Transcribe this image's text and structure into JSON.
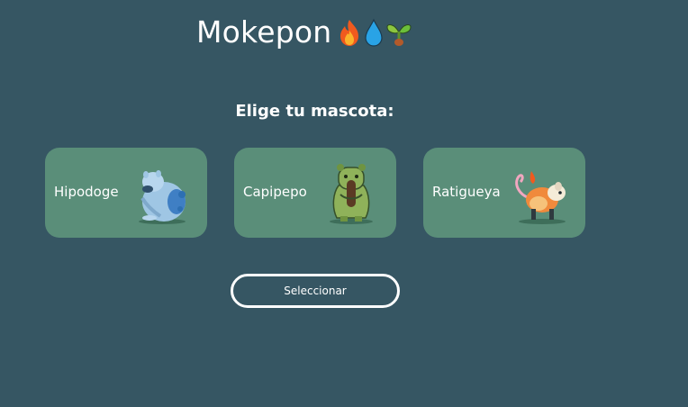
{
  "header": {
    "title": "Mokepon",
    "icons": [
      "fire-icon",
      "water-drop-icon",
      "sprout-icon"
    ]
  },
  "prompt": {
    "text": "Elige tu mascota:"
  },
  "pets": [
    {
      "name": "Hipodoge",
      "image": "hipodoge-image",
      "color": "#6ea8d8"
    },
    {
      "name": "Capipepo",
      "image": "capipepo-image",
      "color": "#8bb35a"
    },
    {
      "name": "Ratigueya",
      "image": "ratigueya-image",
      "color": "#f08a3c"
    }
  ],
  "actions": {
    "select_label": "Seleccionar"
  },
  "colors": {
    "background": "#365663",
    "card": "#5a8e79",
    "text": "#ffffff"
  }
}
